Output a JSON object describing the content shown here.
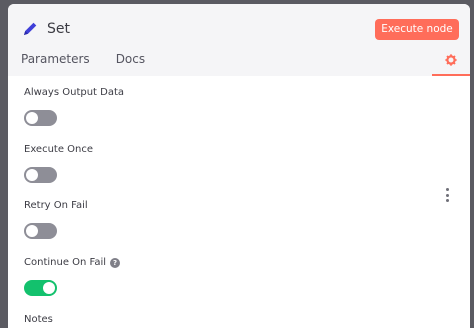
{
  "node": {
    "title": "Set",
    "icon": "pencil-icon",
    "execute_label": "Execute node"
  },
  "tabs": [
    {
      "label": "Parameters"
    },
    {
      "label": "Docs"
    }
  ],
  "settings_tab": {
    "icon": "gear-icon",
    "active": true
  },
  "settings": [
    {
      "label": "Always Output Data",
      "enabled": false
    },
    {
      "label": "Execute Once",
      "enabled": false
    },
    {
      "label": "Retry On Fail",
      "enabled": false
    },
    {
      "label": "Continue On Fail",
      "enabled": true,
      "help_icon": "question-circle-icon"
    },
    {
      "label": "Notes"
    }
  ],
  "colors": {
    "accent": "#ff6d5a",
    "toggle_on": "#13c16d",
    "toggle_off": "#8e8e97",
    "header_bg": "#f5f5f7"
  }
}
